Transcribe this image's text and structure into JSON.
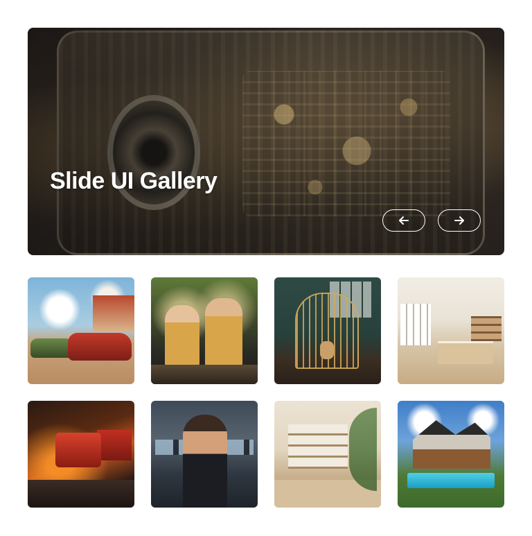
{
  "hero": {
    "title": "Slide UI Gallery",
    "prev_label": "previous slide",
    "next_label": "next slide"
  },
  "gallery": {
    "thumbnails": [
      {
        "icon": "classic-cars-image"
      },
      {
        "icon": "chefs-cooking-image"
      },
      {
        "icon": "dog-in-cage-image"
      },
      {
        "icon": "modern-office-image"
      },
      {
        "icon": "truck-night-image"
      },
      {
        "icon": "businesswoman-image"
      },
      {
        "icon": "library-interior-image"
      },
      {
        "icon": "modern-house-pool-image"
      }
    ]
  },
  "colors": {
    "background": "#ffffff",
    "hero_text": "#ffffff",
    "nav_button_border": "#ffffff"
  }
}
